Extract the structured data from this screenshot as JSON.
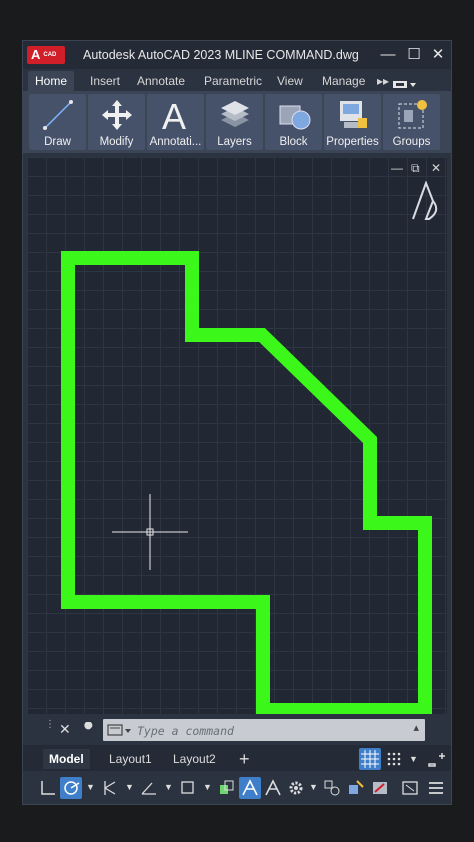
{
  "app": {
    "logo_text": "A",
    "logo_sub": "CAD",
    "title": "Autodesk AutoCAD 2023    MLINE COMMAND.dwg"
  },
  "window_controls": {
    "minimize": "—",
    "maximize": "☐",
    "close": "✕"
  },
  "tabs": [
    {
      "label": "Home",
      "active": true
    },
    {
      "label": "Insert"
    },
    {
      "label": "Annotate"
    },
    {
      "label": "Parametric"
    },
    {
      "label": "View"
    },
    {
      "label": "Manage"
    }
  ],
  "tabs_overflow": "▸▸",
  "ribbon": [
    {
      "label": "Draw",
      "icon": "line-icon"
    },
    {
      "label": "Modify",
      "icon": "move-icon"
    },
    {
      "label": "Annotati...",
      "icon": "text-a-icon"
    },
    {
      "label": "Layers",
      "icon": "layers-icon"
    },
    {
      "label": "Block",
      "icon": "block-icon"
    },
    {
      "label": "Properties",
      "icon": "properties-icon"
    },
    {
      "label": "Groups",
      "icon": "groups-icon"
    }
  ],
  "canvas": {
    "viewport_controls": {
      "minimize": "—",
      "restore": "⧉",
      "close": "✕"
    },
    "polyline_color": "#3cf81a",
    "background": "#222833"
  },
  "command": {
    "placeholder": "Type a command"
  },
  "layout_tabs": [
    {
      "label": "Model",
      "active": true
    },
    {
      "label": "Layout1"
    },
    {
      "label": "Layout2"
    }
  ],
  "add_layout": "+",
  "colors": {
    "accent": "#3f7fc9",
    "brand": "#d11f2a",
    "ribbon_bg": "#3b4556"
  }
}
